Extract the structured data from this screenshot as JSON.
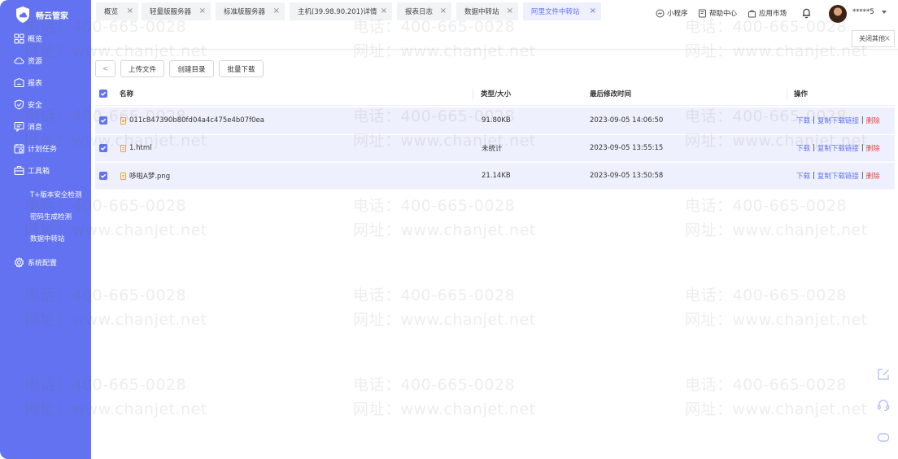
{
  "app": {
    "name": "畅云管家"
  },
  "sidebar": {
    "items": [
      {
        "label": "概览",
        "icon": "grid-icon"
      },
      {
        "label": "资源",
        "icon": "cloud-icon"
      },
      {
        "label": "报表",
        "icon": "report-icon"
      },
      {
        "label": "安全",
        "icon": "shield-icon"
      },
      {
        "label": "消息",
        "icon": "message-icon"
      },
      {
        "label": "计划任务",
        "icon": "schedule-icon"
      },
      {
        "label": "工具箱",
        "icon": "toolbox-icon"
      }
    ],
    "sub_items": [
      "T+版本安全检测",
      "密码生成检测",
      "数据中转站"
    ],
    "config": {
      "label": "系统配置",
      "icon": "gear-icon"
    }
  },
  "header": {
    "mini_program": "小程序",
    "help_center": "帮助中心",
    "app_market": "应用市场",
    "username": "*****5"
  },
  "tabs": [
    {
      "label": "概览",
      "active": false
    },
    {
      "label": "轻量版服务器",
      "active": false
    },
    {
      "label": "标准版服务器",
      "active": false
    },
    {
      "label": "主机(39.98.90.201)详情",
      "active": false
    },
    {
      "label": "报表日志",
      "active": false
    },
    {
      "label": "数据中转站",
      "active": false
    },
    {
      "label": "阿里文件中转站",
      "active": true
    }
  ],
  "close_others": "关闭其他",
  "toolbar": {
    "back": "<",
    "upload": "上传文件",
    "create_dir": "创建目录",
    "batch_download": "批量下载"
  },
  "table": {
    "columns": [
      "名称",
      "类型/大小",
      "最后修改时间",
      "操作"
    ],
    "rows": [
      {
        "name": "011c847390b80fd04a4c475e4b07f0ea",
        "size": "91.80KB",
        "modified": "2023-09-05 14:06:50"
      },
      {
        "name": "1.html",
        "size": "未统计",
        "modified": "2023-09-05 13:55:15"
      },
      {
        "name": "哆啦A梦.png",
        "size": "21.14KB",
        "modified": "2023-09-05 13:50:58"
      }
    ],
    "actions": {
      "download": "下载",
      "copy_link": "复制下载链接",
      "delete": "删除",
      "separator": "|"
    }
  },
  "watermark": {
    "phone": "电话：400-665-0028",
    "site": "网址：www.chanjet.net"
  },
  "colors": {
    "accent": "#6272f0",
    "danger": "#e04848",
    "row_selected": "#eef0fd"
  }
}
